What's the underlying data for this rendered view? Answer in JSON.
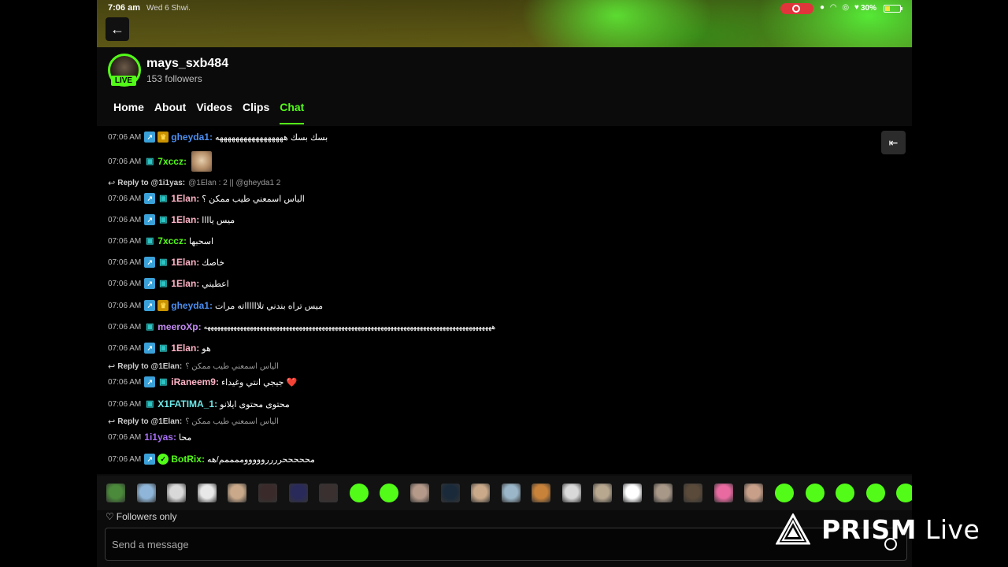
{
  "status_bar": {
    "time": "7:06 am",
    "date": "Wed 6 Shwi.",
    "battery": "30%"
  },
  "channel": {
    "name": "mays_sxb484",
    "followers": "153 followers",
    "live_label": "LIVE"
  },
  "tabs": [
    {
      "label": "Home"
    },
    {
      "label": "About"
    },
    {
      "label": "Videos"
    },
    {
      "label": "Clips"
    },
    {
      "label": "Chat",
      "active": true
    }
  ],
  "chat": {
    "messages": [
      {
        "time": "07:06 AM",
        "badges": [
          "sub",
          "crown"
        ],
        "user": "gheyda1",
        "color": "#4b8ef0",
        "text": "بسك بسك هههههههههههههههههه"
      },
      {
        "time": "07:06 AM",
        "badges": [
          "og"
        ],
        "user": "7xccz",
        "color": "#53fc18",
        "text": "",
        "emote": true
      },
      {
        "time": "07:06 AM",
        "badges": [
          "sub",
          "og"
        ],
        "user": "1Elan",
        "color": "#ffb3c6",
        "text": "الياس اسمعني طيب ممكن ؟"
      },
      {
        "time": "07:06 AM",
        "badges": [
          "sub",
          "og"
        ],
        "user": "1Elan",
        "color": "#ffb3c6",
        "text": "ميس ياااا"
      },
      {
        "time": "07:06 AM",
        "badges": [
          "og"
        ],
        "user": "7xccz",
        "color": "#53fc18",
        "text": "اسحبها"
      },
      {
        "time": "07:06 AM",
        "badges": [
          "sub",
          "og"
        ],
        "user": "1Elan",
        "color": "#ffb3c6",
        "text": "خاصك"
      },
      {
        "time": "07:06 AM",
        "badges": [
          "sub",
          "og"
        ],
        "user": "1Elan",
        "color": "#ffb3c6",
        "text": "اعطيني"
      },
      {
        "time": "07:06 AM",
        "badges": [
          "sub",
          "crown"
        ],
        "user": "gheyda1",
        "color": "#4b8ef0",
        "text": "ميس تراه بندني تلااااااته مرات"
      },
      {
        "time": "07:06 AM",
        "badges": [
          "og"
        ],
        "user": "meeroXp",
        "color": "#c58cf5",
        "text": "ههههههههههههههههههههههههههههههههههههههههههههههههههههههههههههههههههههههههههههههههههههههههه"
      },
      {
        "time": "07:06 AM",
        "badges": [
          "sub",
          "og"
        ],
        "user": "1Elan",
        "color": "#ffb3c6",
        "text": "هو"
      },
      {
        "time": "07:06 AM",
        "badges": [
          "sub",
          "og"
        ],
        "user": "iRaneem9",
        "color": "#ffb3c6",
        "text": "جيجي انتي وغيداء ❤️"
      },
      {
        "time": "07:06 AM",
        "badges": [
          "og"
        ],
        "user": "X1FATIMA_1",
        "color": "#6ee6e6",
        "text": "محتوى محتوى ايلانو"
      },
      {
        "time": "07:06 AM",
        "badges": [],
        "user": "1i1yas",
        "color": "#a86ef5",
        "text": "محا"
      },
      {
        "time": "07:06 AM",
        "badges": [
          "sub",
          "verified"
        ],
        "user": "BotRix",
        "color": "#53fc18",
        "text": "محححححرررروووووممممم/هه"
      }
    ],
    "replies": [
      {
        "label": "Reply to @1i1yas:",
        "text": "@1Elan : 2 || @gheyda1 2"
      },
      {
        "label": "Reply to @1Elan:",
        "text": "الياس اسمعني طيب ممكن ؟"
      },
      {
        "label": "Reply to @1Elan:",
        "text": "الياس اسمعني طيب ممكن ؟"
      }
    ]
  },
  "followers_only": "Followers only",
  "input": {
    "placeholder": "Send a message"
  },
  "watermark": {
    "brand": "PRISM",
    "suffix": " Live"
  },
  "emote_colors": [
    "#4a8a3a",
    "#8fb6d8",
    "#d9d9d9",
    "#e8e8e8",
    "#c9a98a",
    "#3a2a2a",
    "#2a2a5a",
    "#3a3030",
    "#53fc18",
    "#53fc18",
    "#b59a8a",
    "#1a2a3a",
    "#c9a98a",
    "#9ab6c8",
    "#c8823a",
    "#d9d9d9",
    "#b8a890",
    "#ffffff",
    "#a89888",
    "#5a4a3a",
    "#e86aa0",
    "#c8a08a",
    "#53fc18",
    "#53fc18",
    "#53fc18",
    "#53fc18",
    "#53fc18"
  ]
}
